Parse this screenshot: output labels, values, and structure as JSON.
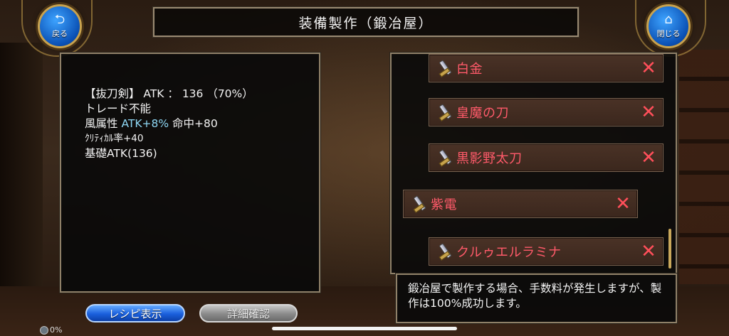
{
  "header": {
    "title": "装備製作（鍛冶屋）",
    "back_label": "戻る",
    "close_label": "閉じる"
  },
  "info": {
    "line1": "【抜刀剣】 ATK ： 136 （70%）",
    "line2": "トレード不能",
    "line3_prefix": "風属性",
    "line3_highlight": "ATK+8%",
    "line3_suffix": "命中+80",
    "line4": "ｸﾘﾃｨｶﾙ率+40",
    "line5": "基礎ATK(136)"
  },
  "recipes": [
    {
      "name": "白金",
      "remove": "✕"
    },
    {
      "name": "皇魔の刀",
      "remove": "✕"
    },
    {
      "name": "黒影野太刀",
      "remove": "✕"
    },
    {
      "name": "紫電",
      "remove": "✕"
    },
    {
      "name": "クルゥエルラミナ",
      "remove": "✕"
    }
  ],
  "message": "鍛冶屋で製作する場合、手数料が発生しますが、製作は100%成功します。",
  "buttons": {
    "recipe_label": "レシピ表示",
    "detail_label": "詳細確認"
  },
  "status": {
    "progress": "0%"
  },
  "colors": {
    "recipe_name": "#ff5a6a",
    "highlight": "#8fd8f5",
    "accent_blue": "#1a5fdc"
  },
  "icons": {
    "back": "return-arrow-icon",
    "close": "home-icon",
    "recipe_item": "sword-icon",
    "remove": "close-x-icon"
  }
}
